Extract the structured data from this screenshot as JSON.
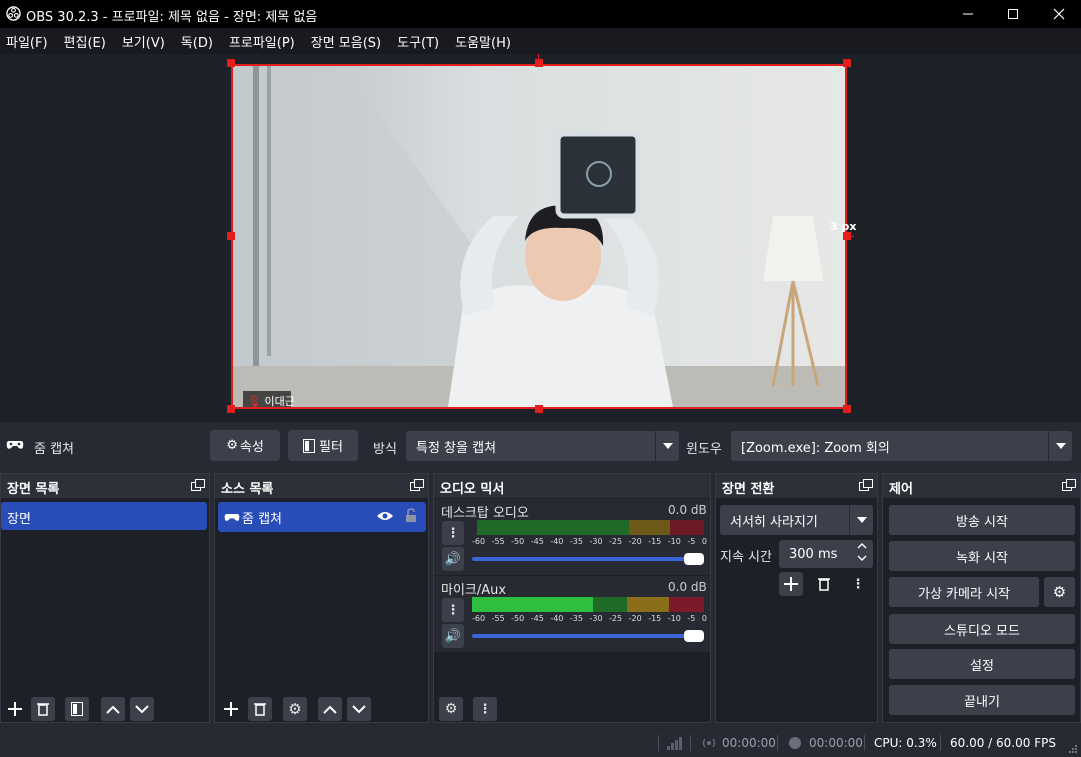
{
  "window": {
    "title": "OBS 30.2.3 - 프로파일: 제목 없음 - 장면: 제목 없음"
  },
  "menu": [
    {
      "label": "파일(F)"
    },
    {
      "label": "편집(E)"
    },
    {
      "label": "보기(V)"
    },
    {
      "label": "독(D)"
    },
    {
      "label": "프로파일(P)"
    },
    {
      "label": "장면 모음(S)"
    },
    {
      "label": "도구(T)"
    },
    {
      "label": "도움말(H)"
    }
  ],
  "preview": {
    "size_readout": "3 px",
    "participant_name": "이대근"
  },
  "source_toolbar": {
    "source_name": "줌 캡쳐",
    "properties_label": "속성",
    "filters_label": "필터",
    "method_label": "방식",
    "method_value": "특정 창을 캡쳐",
    "window_label": "윈도우",
    "window_value": "[Zoom.exe]: Zoom 회의"
  },
  "scenes": {
    "title": "장면 목록",
    "items": [
      {
        "label": "장면"
      }
    ]
  },
  "sources": {
    "title": "소스 목록",
    "items": [
      {
        "label": "줌 캡쳐"
      }
    ]
  },
  "audio_mixer": {
    "title": "오디오 믹서",
    "scale_labels": [
      "-60",
      "-55",
      "-50",
      "-45",
      "-40",
      "-35",
      "-30",
      "-25",
      "-20",
      "-15",
      "-10",
      "-5",
      "0"
    ],
    "channels": [
      {
        "name": "데스크탑 오디오",
        "level": "0.0 dB",
        "volume_fraction": 1.0,
        "peak_fraction": 0.0
      },
      {
        "name": "마이크/Aux",
        "level": "0.0 dB",
        "volume_fraction": 1.0,
        "peak_fraction": 0.5
      }
    ]
  },
  "transitions": {
    "title": "장면 전환",
    "type_value": "서서히 사라지기",
    "duration_label": "지속 시간",
    "duration_value": "300 ms"
  },
  "controls": {
    "title": "제어",
    "start_streaming": "방송 시작",
    "start_recording": "녹화 시작",
    "start_virtualcam": "가상 카메라 시작",
    "studio_mode": "스튜디오 모드",
    "settings": "설정",
    "exit": "끝내기"
  },
  "status": {
    "stream_time": "00:00:00",
    "record_time": "00:00:00",
    "cpu": "CPU: 0.3%",
    "fps": "60.00 / 60.00 FPS"
  },
  "colors": {
    "accent": "#284cb8",
    "selection_border": "#e31e1e",
    "meter_green": "#2fbf3f",
    "meter_yellow": "#c8a028",
    "meter_red": "#c8283c"
  }
}
